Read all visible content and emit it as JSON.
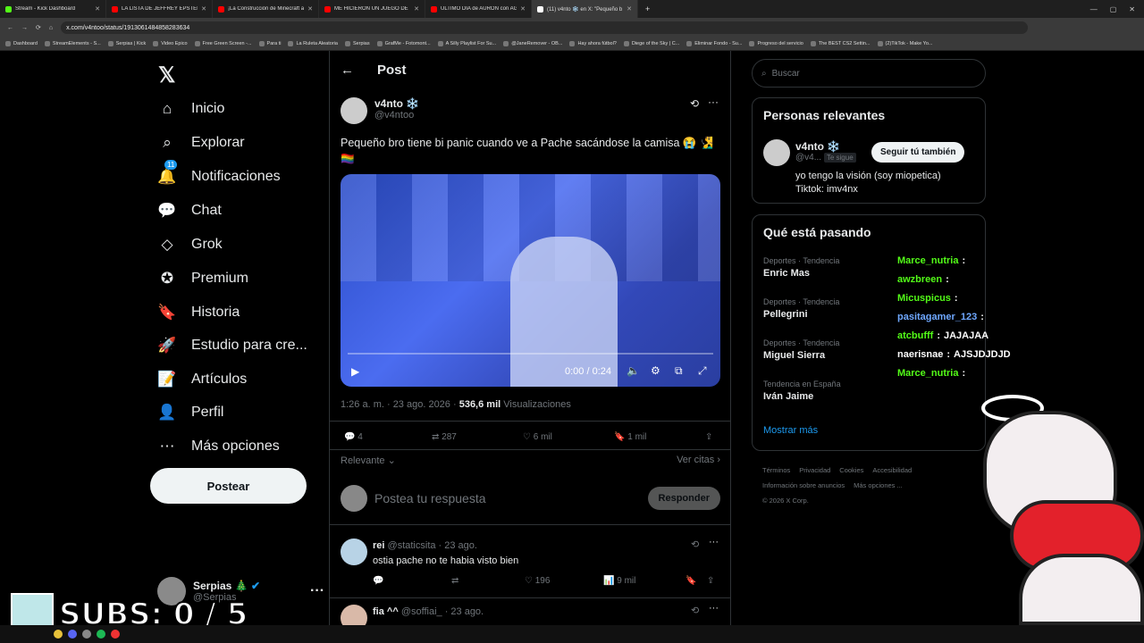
{
  "browser": {
    "tabs": [
      {
        "title": "Stream - Kick Dashboard",
        "color": "#53fc18"
      },
      {
        "title": "LA LISTA DE JEFFREY EPSTEIN Y",
        "color": "#ff0000"
      },
      {
        "title": "¡La Construcción de Minecraft a",
        "color": "#ff0000"
      },
      {
        "title": "ME HICIERON UN JUEGO DE ¡",
        "color": "#ff0000"
      },
      {
        "title": "ULTIMO DIA de AURON con AG",
        "color": "#ff0000"
      },
      {
        "title": "(11) v4nto ❄️ en X: \"Pequeño b",
        "color": "#ffffff"
      }
    ],
    "url": "x.com/v4ntoo/status/1913061484858283634",
    "bookmarks": [
      "Dashboard",
      "StreamElements - S...",
      "Serpias | Kick",
      "Video Epico",
      "Free Green Screen -...",
      "Para ti",
      "La Ruleta Aleatoria",
      "Serpias",
      "GrafMe - Fotomont...",
      "A Silly Playlist For Su...",
      "@JaneRemover - OB...",
      "Hay ahora fútbol?",
      "Diege of the Sky | C...",
      "Eliminar Fondo - Su...",
      "Progreso del servicio",
      "The BEST CS2 Settin...",
      "(2)TikTok - Make Yo..."
    ]
  },
  "nav": {
    "items": [
      "Inicio",
      "Explorar",
      "Notificaciones",
      "Chat",
      "Grok",
      "Premium",
      "Historia",
      "Estudio para cre...",
      "Artículos",
      "Perfil",
      "Más opciones"
    ],
    "notif_badge": "11",
    "post_label": "Postear",
    "profile_name": "Serpias 🎄",
    "profile_handle": "@Serpias"
  },
  "main": {
    "header": "Post",
    "author_name": "v4nto ❄️",
    "author_handle": "@v4ntoo",
    "text": "Pequeño bro tiene bi panic cuando ve a Pache sacándose la camisa 😭 🧏‍♂️🏳️‍🌈",
    "video_time": "0:00 / 0:24",
    "meta_time": "1:26 a. m. · 23 ago. 2026 · ",
    "views": "536,6 mil",
    "views_label": "Visualizaciones",
    "stats": {
      "replies": "4",
      "reposts": "287",
      "likes": "6 mil",
      "bookmarks": "1 mil"
    },
    "sort": "Relevante",
    "quotes": "Ver citas",
    "reply_placeholder": "Postea tu respuesta",
    "reply_button": "Responder",
    "replies": [
      {
        "name": "rei",
        "handle": "@staticsita · 23 ago.",
        "text": "ostia pache no te habia visto bien",
        "likes": "196",
        "views": "9 mil"
      },
      {
        "name": "fia ^^",
        "handle": "@soffiai_ · 23 ago.",
        "text": ""
      }
    ]
  },
  "sidebar": {
    "search_placeholder": "Buscar",
    "relevant_title": "Personas relevantes",
    "relevant_name": "v4nto ❄️",
    "relevant_handle": "@v4...",
    "follows_you": "Te sigue",
    "follow_back": "Seguir tú también",
    "bio1": "yo tengo la visión (soy miopetica)",
    "bio2": "Tiktok: imv4nx",
    "trends_title": "Qué está pasando",
    "trends": [
      {
        "cat": "Deportes · Tendencia",
        "name": "Enric Mas"
      },
      {
        "cat": "Deportes · Tendencia",
        "name": "Pellegrini"
      },
      {
        "cat": "Deportes · Tendencia",
        "name": "Miguel Sierra"
      },
      {
        "cat": "Tendencia en España",
        "name": "Iván Jaime"
      }
    ],
    "show_more": "Mostrar más",
    "footer": [
      "Términos",
      "Privacidad",
      "Cookies",
      "Accesibilidad",
      "Información sobre anuncios",
      "Más opciones ...",
      "© 2026 X Corp."
    ]
  },
  "overlay": {
    "chat": [
      {
        "user": "Marce_nutria",
        "msg": "",
        "color": "#53fc18"
      },
      {
        "user": "awzbreen",
        "msg": "",
        "color": "#53fc18"
      },
      {
        "user": "Micuspicus",
        "msg": "",
        "color": "#53fc18"
      },
      {
        "user": "pasitagamer_123",
        "msg": "",
        "color": "#6fa8ff"
      },
      {
        "user": "atcbufff",
        "msg": "JAJAJAA",
        "color": "#53fc18"
      },
      {
        "user": "naerisnae",
        "msg": "AJSJDJDJD",
        "color": "#ffffff"
      },
      {
        "user": "Marce_nutria",
        "msg": "",
        "color": "#53fc18"
      }
    ],
    "subs": "SUBS: 0 / 5"
  }
}
